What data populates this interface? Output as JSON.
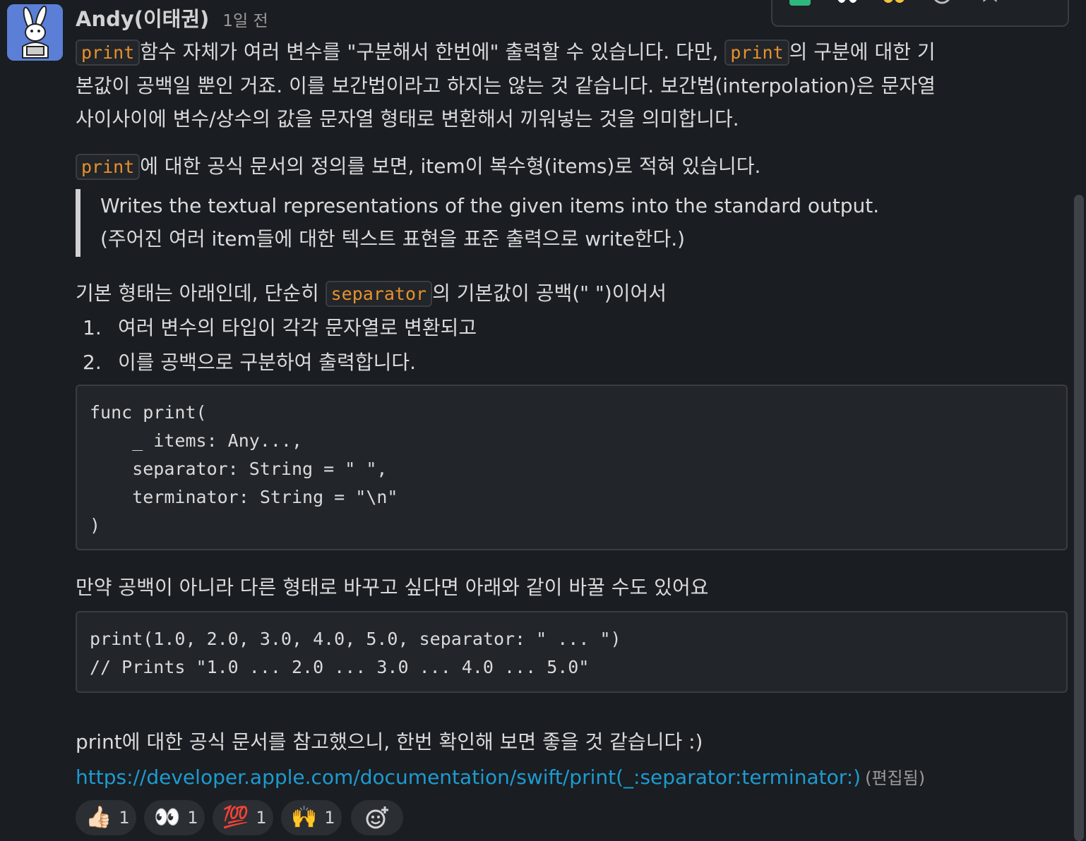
{
  "message": {
    "author": "Andy(이태권)",
    "time": "1일 전",
    "p1": {
      "l1_code_a": "print",
      "l1_text_a": "함수 자체가 여러 변수를 \"구분해서 한번에\" 출력할 수 있습니다.  다만, ",
      "l1_code_b": "print",
      "l1_text_b": "의 구분에 대한 기",
      "l2": "본값이 공백일 뿐인 거죠. 이를 보간법이라고 하지는 않는 것 같습니다. 보간법(interpolation)은 문자열",
      "l3": "사이사이에 변수/상수의 값을 문자열 형태로 변환해서 끼워넣는 것을 의미합니다."
    },
    "p2": {
      "code": "print",
      "text": "에 대한 공식 문서의 정의를 보면, item이 복수형(items)로 적혀 있습니다."
    },
    "quote": {
      "l1": "Writes the textual representations of the given items into the standard output.",
      "l2": "(주어진 여러 item들에 대한 텍스트 표현을 표준 출력으로 write한다.)"
    },
    "p3": {
      "before": "기본 형태는 아래인데, 단순히 ",
      "code": "separator",
      "after": "의 기본값이 공백(\" \")이어서"
    },
    "list": [
      {
        "num": "1.",
        "text": "여러 변수의 타입이 각각 문자열로 변환되고"
      },
      {
        "num": "2.",
        "text": "이를 공백으로 구분하여 출력합니다."
      }
    ],
    "code1": "func print(\n    _ items: Any...,\n    separator: String = \" \",\n    terminator: String = \"\\n\"\n)",
    "p4": "만약 공백이 아니라 다른 형태로 바꾸고 싶다면 아래와 같이 바꿀 수도 있어요",
    "code2": "print(1.0, 2.0, 3.0, 4.0, 5.0, separator: \" ... \")\n// Prints \"1.0 ... 2.0 ... 3.0 ... 4.0 ... 5.0\"",
    "p5": "print에 대한 공식 문서를 참고했으니, 한번 확인해 보면 좋을 것 같습니다 :)",
    "link": "https://developer.apple.com/documentation/swift/print(_:separator:terminator:)",
    "edited": "(편집됨)"
  },
  "reactions": [
    {
      "icon": "thumbs-up-icon",
      "emoji": "👍🏻",
      "count": "1"
    },
    {
      "icon": "eyes-icon",
      "emoji": "👀",
      "count": "1"
    },
    {
      "icon": "hundred-points-icon",
      "emoji": "💯",
      "count": "1"
    },
    {
      "icon": "raising-hands-icon",
      "emoji": "🙌",
      "count": "1"
    }
  ],
  "add_reaction_icon": "add-reaction-icon",
  "colors": {
    "background": "#1a1d21",
    "code_inline": "#e8912d",
    "link": "#1d9bd1",
    "avatar_bg": "#5b7fd6"
  }
}
